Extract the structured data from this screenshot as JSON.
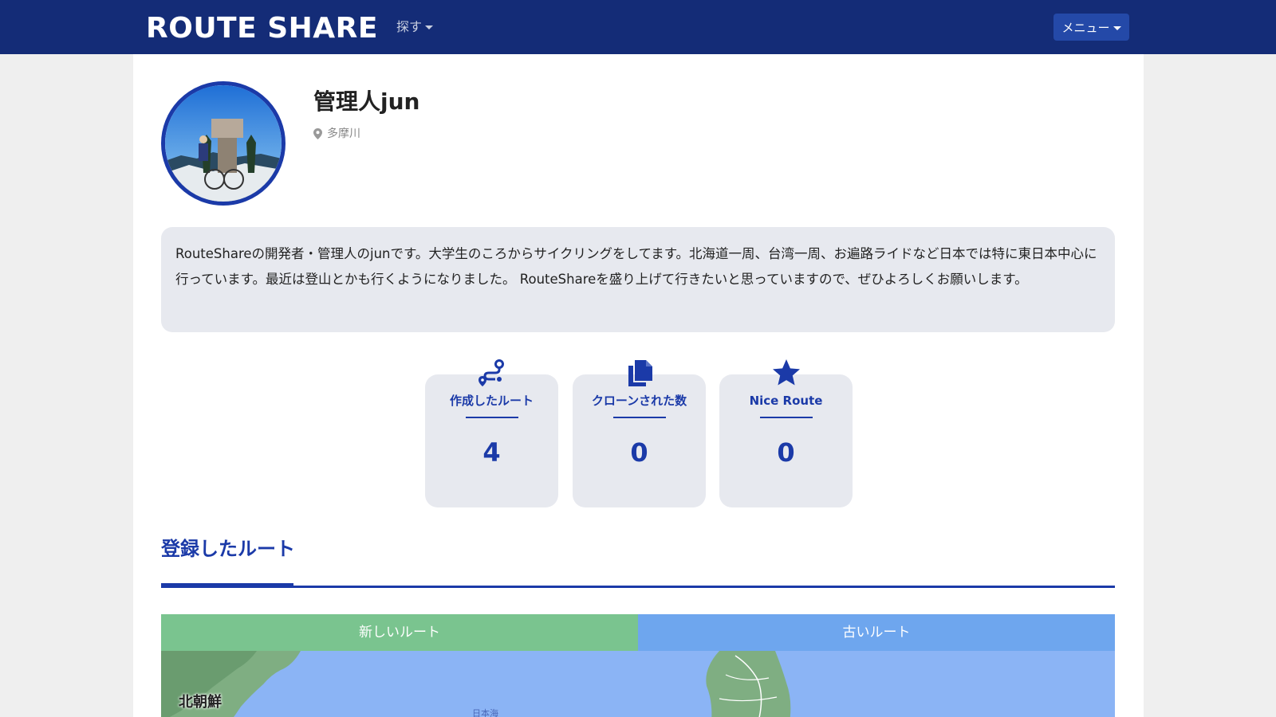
{
  "navbar": {
    "logo": "ROUTE SHARE",
    "search_label": "探す",
    "menu_label": "メニュー"
  },
  "profile": {
    "name": "管理人jun",
    "location": "多摩川",
    "bio": "RouteShareの開発者・管理人のjunです。大学生のころからサイクリングをしてます。北海道一周、台湾一周、お遍路ライドなど日本では特に東日本中心に行っています。最近は登山とかも行くようになりました。 RouteShareを盛り上げて行きたいと思っていますので、ぜひよろしくお願いします。"
  },
  "stats": [
    {
      "icon": "route-icon",
      "label": "作成したルート",
      "value": "4"
    },
    {
      "icon": "copy-icon",
      "label": "クローンされた数",
      "value": "0"
    },
    {
      "icon": "star-icon",
      "label": "Nice Route",
      "value": "0"
    }
  ],
  "routes_section": {
    "title": "登録したルート",
    "tabs": [
      {
        "label": "新しいルート",
        "color": "#7ac48f"
      },
      {
        "label": "古いルート",
        "color": "#6ea6ee"
      }
    ]
  },
  "map": {
    "label_korea": "北朝鮮",
    "label_sea": "日本海"
  },
  "colors": {
    "navbar": "#142c77",
    "accent": "#1b3aa8",
    "card_bg": "#e7e9ef"
  }
}
